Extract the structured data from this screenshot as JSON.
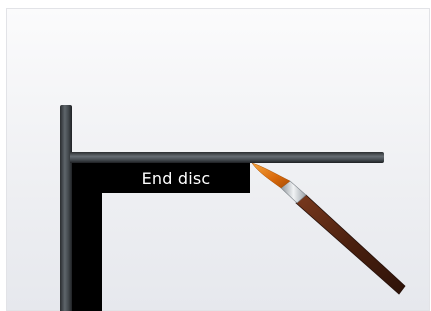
{
  "scene": {
    "label": "End disc",
    "icons": [
      "paintbrush-icon"
    ],
    "colors": {
      "background": "#eff0f3",
      "pole": "#4a5055",
      "label_bg": "#000000",
      "label_text": "#ffffff",
      "brush_handle": "#5a2a16",
      "brush_bristles": "#e07a10",
      "brush_ferrule": "#c9ced3"
    }
  }
}
